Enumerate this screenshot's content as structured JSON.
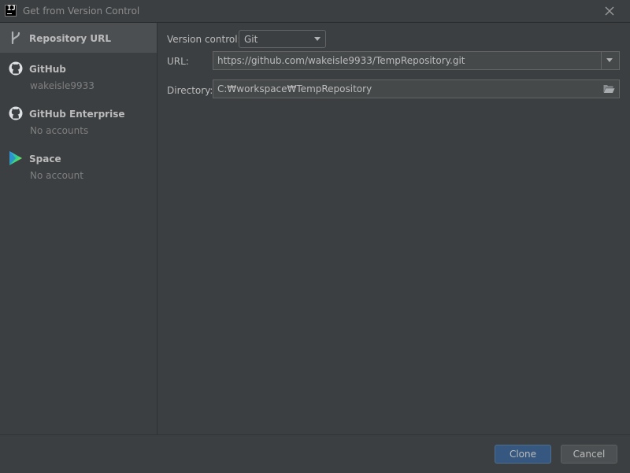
{
  "window": {
    "title": "Get from Version Control",
    "close_icon": "close-icon"
  },
  "sidebar": {
    "items": [
      {
        "label": "Repository URL",
        "sub": "",
        "icon": "vcs-branch-icon",
        "selected": true
      },
      {
        "label": "GitHub",
        "sub": "wakeisle9933",
        "icon": "github-icon",
        "selected": false
      },
      {
        "label": "GitHub Enterprise",
        "sub": "No accounts",
        "icon": "github-icon",
        "selected": false
      },
      {
        "label": "Space",
        "sub": "No account",
        "icon": "space-icon",
        "selected": false
      }
    ]
  },
  "form": {
    "version_control_label": "Version control:",
    "version_control_value": "Git",
    "url_label": "URL:",
    "url_value": "https://github.com/wakeisle9933/TempRepository.git",
    "directory_label": "Directory:",
    "directory_value": "C:₩workspace₩TempRepository"
  },
  "footer": {
    "clone_label": "Clone",
    "cancel_label": "Cancel"
  },
  "colors": {
    "background": "#3c3f41",
    "selected_item": "#4b4f52",
    "primary_button": "#365880",
    "text": "#bbbbbb",
    "muted_text": "#7f7f7f"
  }
}
